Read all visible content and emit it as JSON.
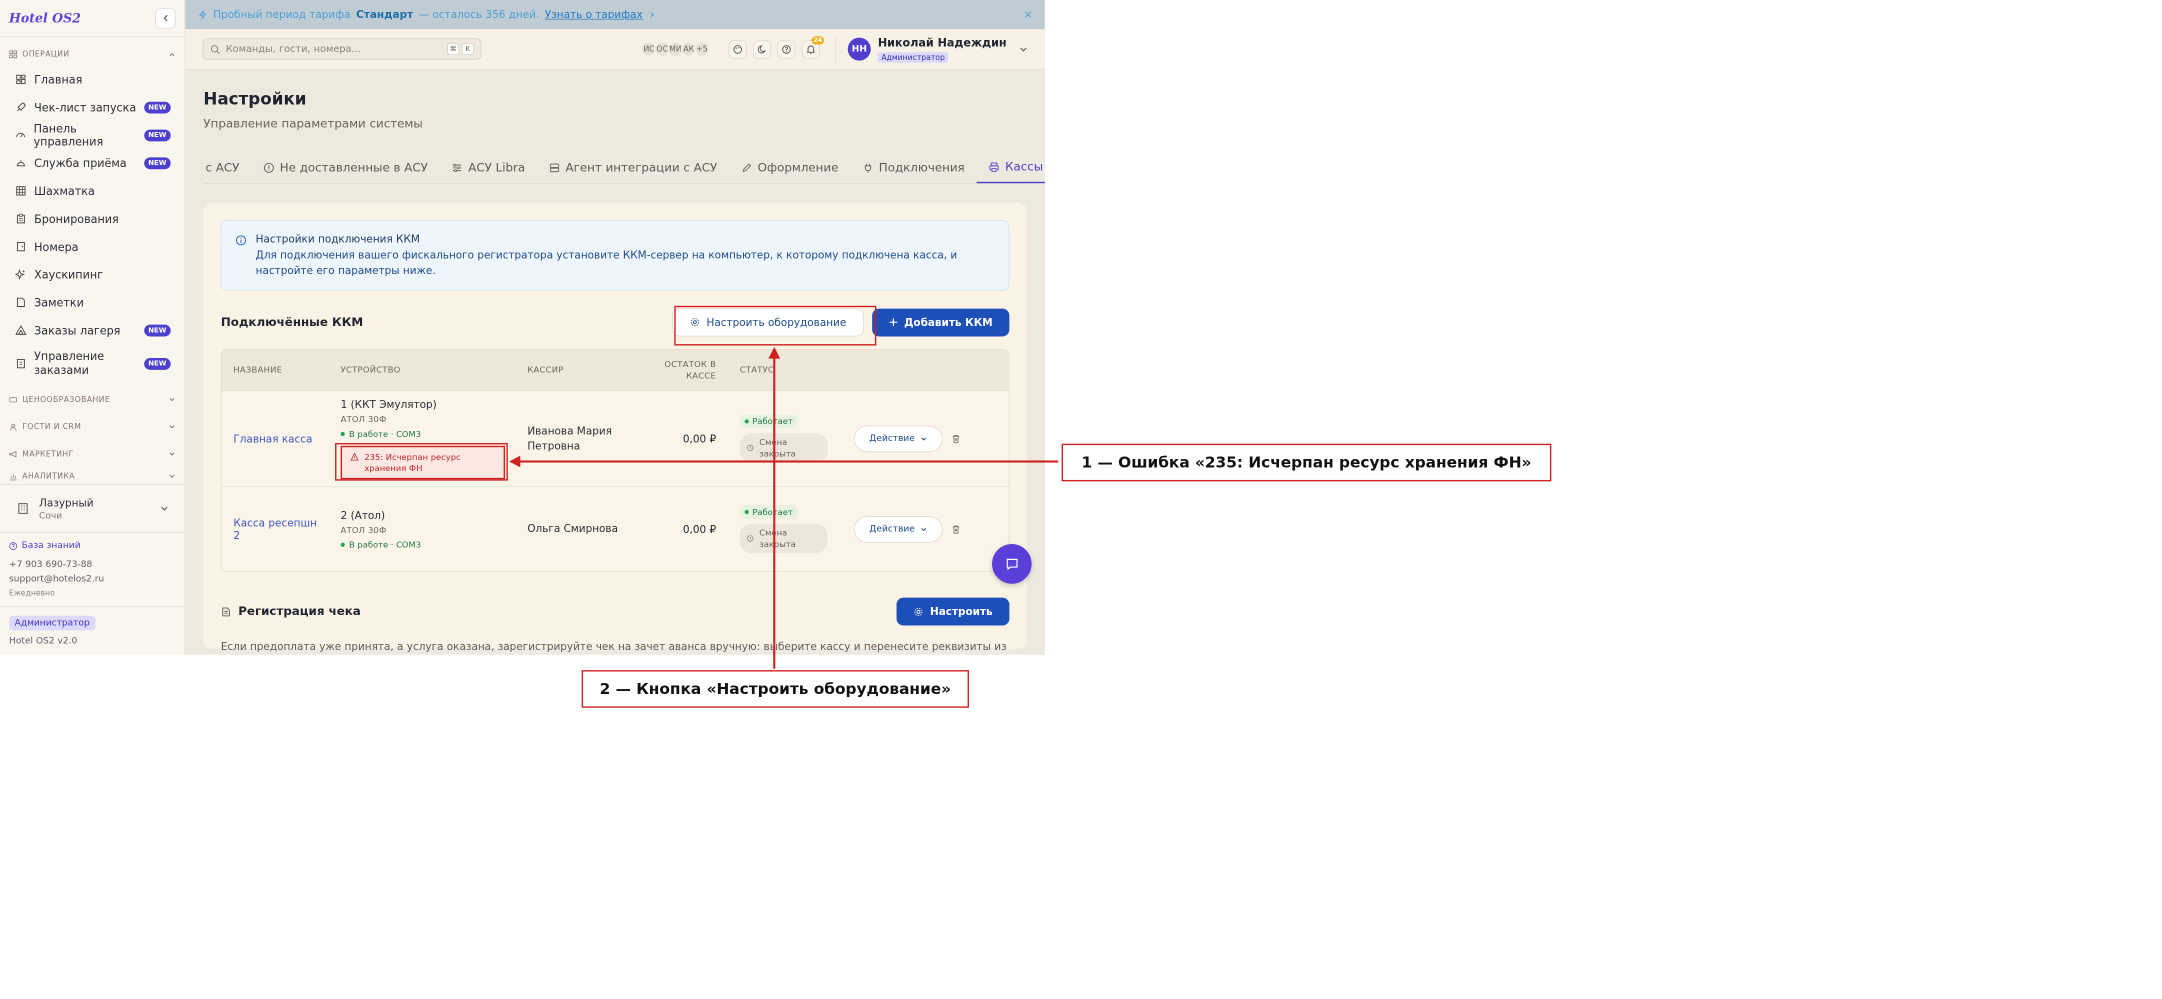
{
  "sidebar": {
    "logo": "Hotel OS2",
    "section_ops": "ОПЕРАЦИИ",
    "items": [
      {
        "label": "Главная",
        "badge": ""
      },
      {
        "label": "Чек-лист запуска",
        "badge": "NEW"
      },
      {
        "label": "Панель управления",
        "badge": "NEW"
      },
      {
        "label": "Служба приёма",
        "badge": "NEW"
      },
      {
        "label": "Шахматка",
        "badge": ""
      },
      {
        "label": "Бронирования",
        "badge": ""
      },
      {
        "label": "Номера",
        "badge": ""
      },
      {
        "label": "Хаускипинг",
        "badge": ""
      },
      {
        "label": "Заметки",
        "badge": ""
      },
      {
        "label": "Заказы лагеря",
        "badge": "NEW"
      },
      {
        "label": "Управление заказами",
        "badge": "NEW"
      }
    ],
    "collapsed_sections": [
      "ЦЕНООБРАЗОВАНИЕ",
      "ГОСТИ И CRM",
      "МАРКЕТИНГ",
      "АНАЛИТИКА"
    ],
    "hotel": {
      "name": "Лазурный",
      "city": "Сочи"
    },
    "knowledge_base": "База знаний",
    "phone": "+7 903 690-73-88",
    "email": "support@hotelos2.ru",
    "schedule": "Ежедневно",
    "role": "Администратор",
    "version": "Hotel OS2 v2.0"
  },
  "trial": {
    "prefix": "Пробный период тарифа",
    "plan": "Стандарт",
    "suffix": "— осталось 356 дней.",
    "link": "Узнать о тарифах"
  },
  "topbar": {
    "search_placeholder": "Команды, гости, номера...",
    "kbd1": "⌘",
    "kbd2": "K",
    "avatars": [
      "ИС",
      "ОС",
      "МИ",
      "АК",
      "+5"
    ],
    "notifications": "24",
    "user_initials": "НН",
    "user_name": "Николай Надеждин",
    "user_role": "Администратор"
  },
  "page": {
    "title": "Настройки",
    "subtitle": "Управление параметрами системы",
    "tabs": [
      "с АСУ",
      "Не доставленные в АСУ",
      "АСУ Libra",
      "Агент интеграции с АСУ",
      "Оформление",
      "Подключения",
      "Кассы"
    ]
  },
  "info": {
    "title": "Настройки подключения ККМ",
    "text": "Для подключения вашего фискального регистратора установите ККМ-сервер на компьютер, к которому подключена касса, и настройте его параметры ниже."
  },
  "kkm": {
    "title": "Подключённые ККМ",
    "configure_btn": "Настроить оборудование",
    "add_btn": "Добавить ККМ",
    "columns": [
      "НАЗВАНИЕ",
      "УСТРОЙСТВО",
      "КАССИР",
      "ОСТАТОК В КАССЕ",
      "СТАТУС"
    ],
    "rows": [
      {
        "name": "Главная касса",
        "device": "1 (ККТ Эмулятор)",
        "model": "АТОЛ 30Ф",
        "device_status": "В работе · COM3",
        "error": "235: Исчерпан ресурс хранения ФН",
        "cashier": "Иванова Мария Петровна",
        "balance": "0,00 ₽",
        "status": "Работает",
        "shift": "Смена закрыта",
        "action": "Действие"
      },
      {
        "name": "Касса ресепшн 2",
        "device": "2 (Атол)",
        "model": "АТОЛ 30Ф",
        "device_status": "В работе · COM3",
        "error": "",
        "cashier": "Ольга Смирнова",
        "balance": "0,00 ₽",
        "status": "Работает",
        "shift": "Смена закрыта",
        "action": "Действие"
      }
    ]
  },
  "receipt": {
    "title": "Регистрация чека",
    "button": "Настроить",
    "text": "Если предоплата уже принята, а услуга оказана, зарегистрируйте чек на зачет аванса вручную: выберите кассу и перенесите реквизиты из чека аванса."
  },
  "annotations": {
    "a1": "1 — Ошибка «235: Исчерпан ресурс хранения ФН»",
    "a2": "2 — Кнопка «Настроить оборудование»"
  },
  "colors": {
    "accent": "#4b3fd0",
    "primary_btn": "#1d4fb8",
    "annotation": "#cf2020"
  }
}
